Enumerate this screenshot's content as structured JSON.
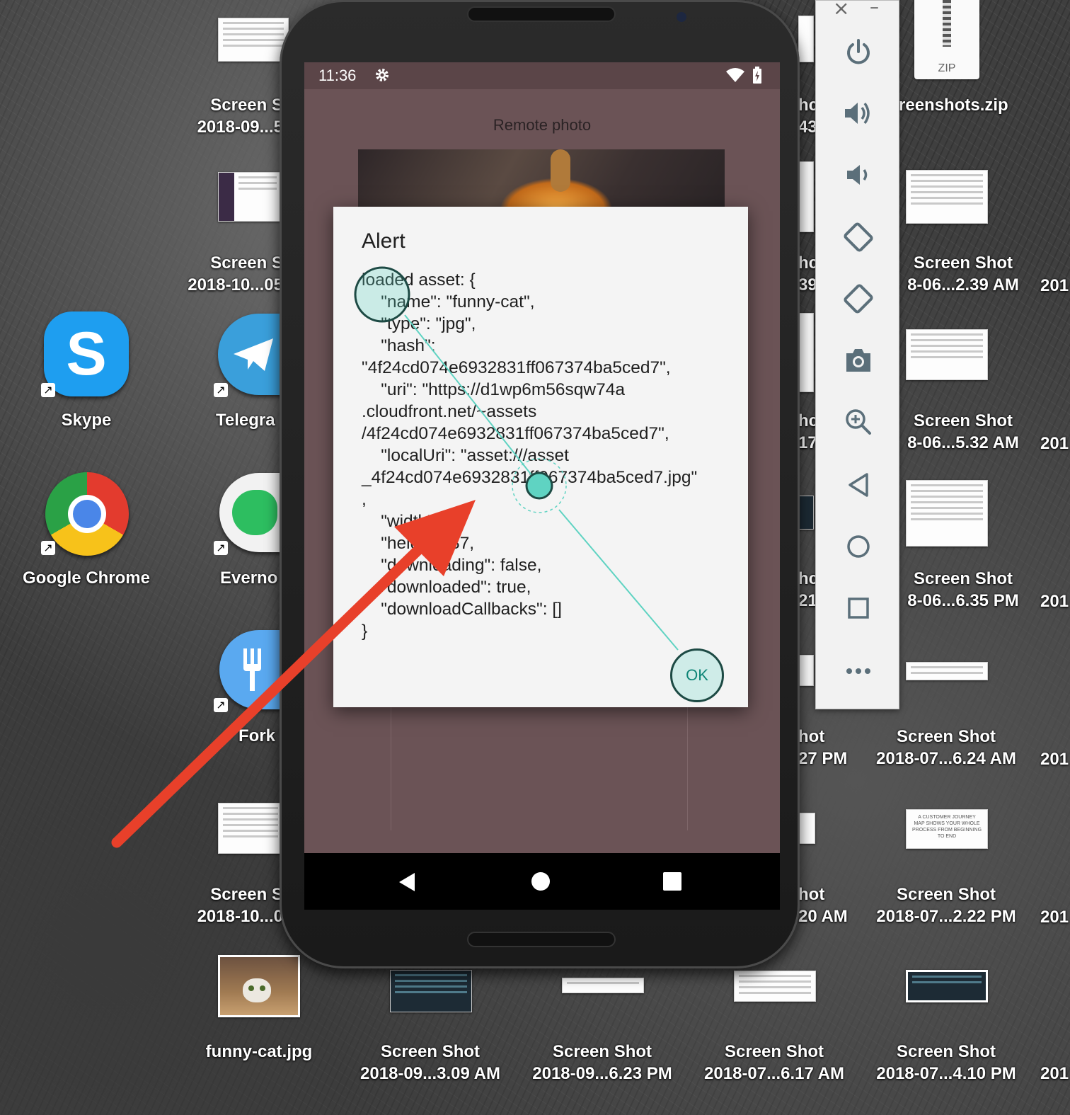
{
  "desktop": {
    "top_label": [
      "Screen S",
      "2018-09...5"
    ],
    "label_2": [
      "Screen S",
      "2018-10...05"
    ],
    "label_6": [
      "Screen S",
      "2018-10...0"
    ],
    "apps": {
      "skype": "Skype",
      "telegram": "Telegra",
      "chrome": "Google Chrome",
      "evernote": "Everno",
      "fork": "Fork"
    },
    "funny_cat": "funny-cat.jpg",
    "zip_badge": "ZIP",
    "zip_name": "reenshots.zip",
    "right_col": [
      [
        "Screen Shot",
        "8-06...2.39 AM"
      ],
      [
        "Screen Shot",
        "8-06...5.32 AM"
      ],
      [
        "Screen Shot",
        "8-06...6.35 PM"
      ],
      [
        "Screen Shot",
        "2018-07...6.24 AM"
      ],
      [
        "Screen Shot",
        "2018-07...2.22 PM"
      ]
    ],
    "edge_col": [
      "201",
      "201",
      "201",
      "201",
      "201"
    ],
    "partial_col": [
      [
        "hc",
        "43"
      ],
      [
        "hc",
        "39"
      ],
      [
        "hc",
        "17"
      ],
      [
        "hc",
        "21"
      ],
      [
        "hot",
        "27 PM"
      ],
      [
        "hot",
        "20 AM"
      ]
    ],
    "bottom_row": [
      [
        "Screen Shot",
        "2018-09...3.09 AM"
      ],
      [
        "Screen Shot",
        "2018-09...6.23 PM"
      ],
      [
        "Screen Shot",
        "2018-07...6.17 AM"
      ],
      [
        "Screen Shot",
        "2018-07...4.10 PM"
      ]
    ],
    "bottom_edge": "201",
    "thumb_journey": "A CUSTOMER JOURNEY MAP SHOWS YOUR WHOLE PROCESS FROM BEGINNING TO END"
  },
  "device": {
    "status_time": "11:36",
    "header": "Remote photo",
    "dialog": {
      "title": "Alert",
      "message": "loaded asset: {\n    \"name\": \"funny-cat\",\n    \"type\": \"jpg\",\n    \"hash\":\n\"4f24cd074e6932831ff067374ba5ced7\",\n    \"uri\": \"https://d1wp6m56sqw74a\n.cloudfront.net/~assets\n/4f24cd074e6932831ff067374ba5ced7\",\n    \"localUri\": \"asset:///asset\n_4f24cd074e6932831ff067374ba5ced7.jpg\"\n,\n    \"width\": 2,\n    \"height\": 87,\n    \"downloading\": false,\n    \"downloaded\": true,\n    \"downloadCallbacks\": []\n}",
      "ok": "OK"
    }
  },
  "emulator_toolbar": {
    "close": "×",
    "minimize": "–",
    "icons": [
      "power-icon",
      "volume-up-icon",
      "volume-down-icon",
      "rotate-left-icon",
      "rotate-right-icon",
      "camera-icon",
      "zoom-icon",
      "back-icon",
      "home-icon",
      "overview-icon",
      "more-icon"
    ]
  },
  "colors": {
    "screen_bg": "#6b5356",
    "dialog_bg": "#f4f4f4",
    "touch_accent": "#5fd3c2",
    "arrow": "#e8402a"
  }
}
